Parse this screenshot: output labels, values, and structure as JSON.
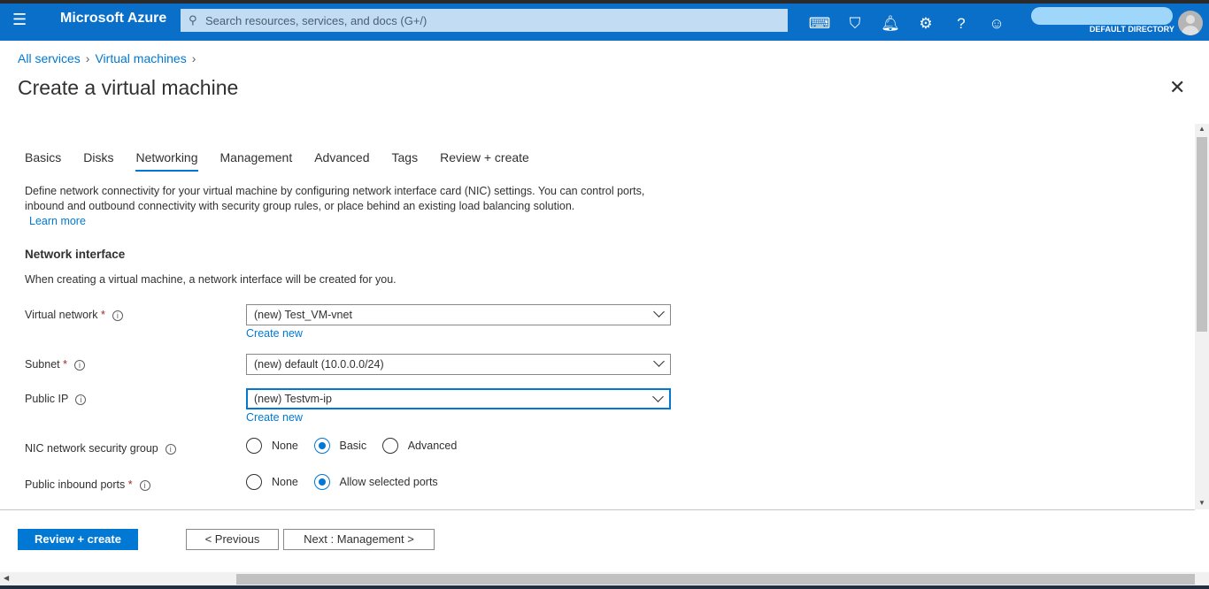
{
  "header": {
    "menu_icon": "hamburger-icon",
    "brand": "Microsoft Azure",
    "search_placeholder": "Search resources, services, and docs (G+/)",
    "directory": "DEFAULT DIRECTORY",
    "icons": [
      "cloud-shell-icon",
      "directory-filter-icon",
      "bell-icon",
      "gear-icon",
      "help-icon",
      "feedback-smiley-icon"
    ]
  },
  "breadcrumb": {
    "items": [
      "All services",
      "Virtual machines"
    ]
  },
  "page": {
    "title": "Create a virtual machine"
  },
  "tabs": [
    "Basics",
    "Disks",
    "Networking",
    "Management",
    "Advanced",
    "Tags",
    "Review + create"
  ],
  "active_tab": "Networking",
  "intro": {
    "text": "Define network connectivity for your virtual machine by configuring network interface card (NIC) settings. You can control ports, inbound and outbound connectivity with security group rules, or place behind an existing load balancing solution.",
    "learn_more": "Learn more"
  },
  "section": {
    "title": "Network interface",
    "description": "When creating a virtual machine, a network interface will be created for you."
  },
  "fields": {
    "vnet": {
      "label": "Virtual network",
      "value": "(new) Test_VM-vnet",
      "create_new": "Create new"
    },
    "subnet": {
      "label": "Subnet",
      "value": "(new) default (10.0.0.0/24)"
    },
    "public_ip": {
      "label": "Public IP",
      "value": "(new) Testvm-ip",
      "create_new": "Create new"
    },
    "nsg": {
      "label": "NIC network security group",
      "options": [
        "None",
        "Basic",
        "Advanced"
      ],
      "selected": "Basic"
    },
    "inbound": {
      "label": "Public inbound ports",
      "options": [
        "None",
        "Allow selected ports"
      ],
      "selected": "Allow selected ports"
    }
  },
  "footer": {
    "review": "Review + create",
    "previous": "< Previous",
    "next": "Next : Management >"
  },
  "colors": {
    "accent": "#0078d4",
    "topbar": "#0a6fc9"
  }
}
